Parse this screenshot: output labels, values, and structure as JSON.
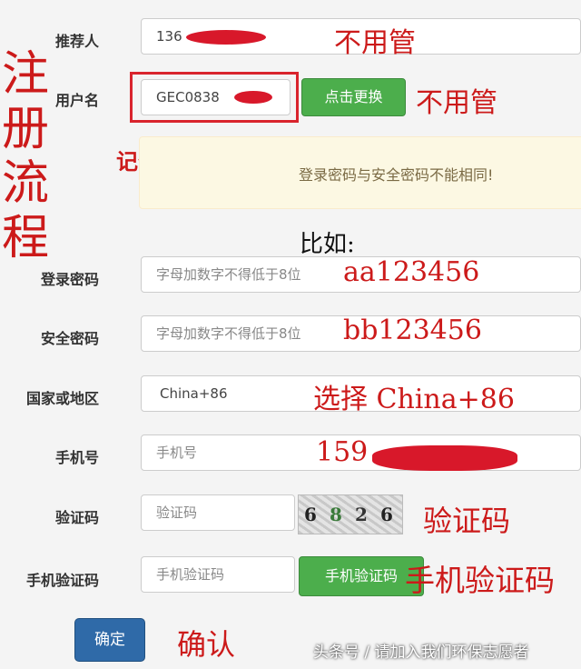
{
  "form": {
    "referrer": {
      "label": "推荐人",
      "value": "136"
    },
    "username": {
      "label": "用户名",
      "value": "GEC0838",
      "change_button": "点击更换"
    },
    "alert_text": "登录密码与安全密码不能相同!",
    "login_password": {
      "label": "登录密码",
      "placeholder": "字母加数字不得低于8位"
    },
    "security_password": {
      "label": "安全密码",
      "placeholder": "字母加数字不得低于8位"
    },
    "country": {
      "label": "国家或地区",
      "value": "China+86"
    },
    "phone": {
      "label": "手机号",
      "placeholder": "手机号"
    },
    "captcha": {
      "label": "验证码",
      "placeholder": "验证码",
      "image_chars": [
        "6",
        "8",
        "2",
        "6"
      ]
    },
    "sms_code": {
      "label": "手机验证码",
      "placeholder": "手机验证码",
      "button": "手机验证码"
    },
    "confirm_button": "确定"
  },
  "annotations": {
    "title": "注册流程",
    "ignore_1": "不用管",
    "ignore_2": "不用管",
    "remember": "记住登陆使用",
    "example": "比如:",
    "login_pw_example": "aa123456",
    "security_pw_example": "bb123456",
    "country_select": "选择 China+86",
    "phone_example": "159",
    "captcha_note": "验证码",
    "sms_note": "手机验证码",
    "confirm_note": "确认"
  },
  "watermark": "头条号 / 请加入我们环保志愿者",
  "colors": {
    "annotation_red": "#cc1a1a",
    "green_button": "#4cae4c",
    "blue_button": "#2f6aa8",
    "alert_bg": "#fcf8e3"
  }
}
